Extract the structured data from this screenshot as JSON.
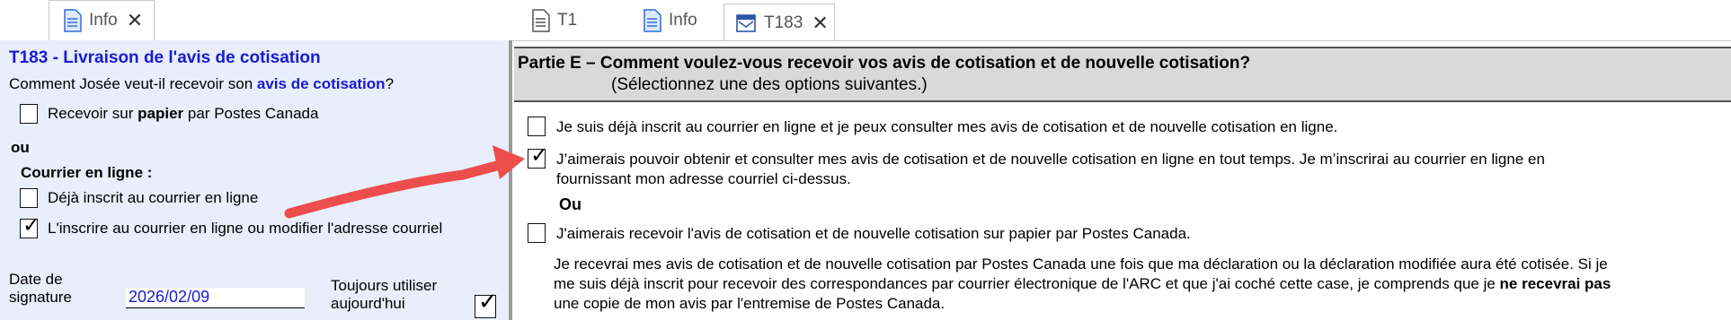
{
  "tabs": {
    "left": [
      {
        "label": "Info",
        "close": "✕"
      }
    ],
    "right": [
      {
        "label": "T1"
      },
      {
        "label": "Info"
      },
      {
        "label": "T183",
        "close": "✕"
      }
    ]
  },
  "left": {
    "title": "T183 - Livraison de l'avis de cotisation",
    "question_prefix": "Comment Josée veut-il recevoir son ",
    "question_emph": "avis de cotisation",
    "question_suffix": "?",
    "paper_prefix": "Recevoir sur ",
    "paper_bold": "papier",
    "paper_suffix": " par Postes Canada",
    "or": "ou",
    "online_heading": "Courrier en ligne :",
    "opt_already": "Déjà inscrit au courrier en ligne",
    "opt_register": "L'inscrire au courrier en ligne ou modifier l'adresse courriel",
    "date_label_1": "Date de",
    "date_label_2": "signature",
    "date_value": "2026/02/09",
    "today_label_1": "Toujours utiliser",
    "today_label_2": "aujourd'hui",
    "checks": {
      "paper": false,
      "already": false,
      "register": true,
      "today": true
    }
  },
  "form": {
    "header_line1": "Partie E – Comment voulez-vous recevoir vos avis de cotisation et de nouvelle cotisation?",
    "header_line2": "(Sélectionnez une des options suivantes.)",
    "opt1": "Je suis déjà inscrit au courrier en ligne et je peux consulter mes avis de cotisation et de nouvelle cotisation en ligne.",
    "opt2_line1": "J’aimerais pouvoir obtenir et consulter mes avis de cotisation et de nouvelle cotisation en ligne en tout temps. Je m’inscrirai au courrier en ligne en",
    "opt2_line2": "fournissant mon adresse courriel ci-dessus.",
    "or": "Ou",
    "opt3": "J'aimerais recevoir l'avis de cotisation et de nouvelle cotisation sur papier par Postes Canada.",
    "note_line1": "Je recevrai mes avis de cotisation et de nouvelle cotisation par Postes Canada une fois que ma déclaration ou la déclaration modifiée aura été cotisée. Si je",
    "note_line2_prefix": "me suis déjà inscrit pour recevoir des correspondances par courrier électronique de l'ARC et que j'ai coché cette case, je comprends que je ",
    "note_line2_bold": "ne recevrai pas",
    "note_line3": "une copie de mon avis par l'entremise de Postes Canada.",
    "checks": {
      "opt1": false,
      "opt2": true,
      "opt3": false
    }
  },
  "check_glyph": "✓",
  "colors": {
    "accent": "#1a1ad4",
    "pane": "#e8eefb",
    "header": "#d9d9d9",
    "arrow": "#ee4d4d"
  }
}
